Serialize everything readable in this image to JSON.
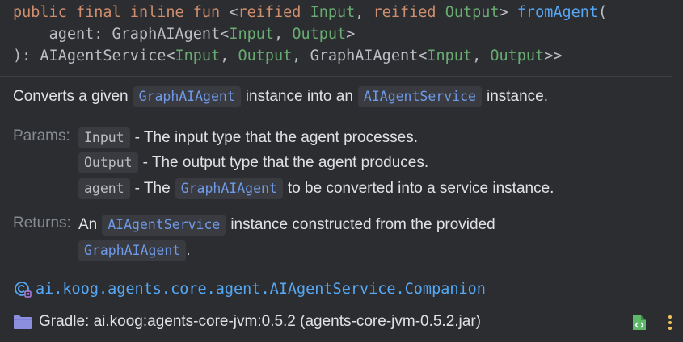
{
  "signature": {
    "line1": {
      "kw_public": "public",
      "kw_final": "final",
      "kw_inline": "inline",
      "kw_fun": "fun",
      "lt": "<",
      "kw_reified1": "reified",
      "type_input": "Input",
      "comma": ",",
      "kw_reified2": "reified",
      "type_output": "Output",
      "gt": ">",
      "fn_name": "fromAgent",
      "paren_open": "("
    },
    "line2": {
      "param": "agent: GraphAIAgent<",
      "type_input": "Input",
      "comma": ", ",
      "type_output": "Output",
      "close": ">"
    },
    "line3": {
      "start": "): AIAgentService<",
      "type_input1": "Input",
      "comma1": ", ",
      "type_output1": "Output",
      "mid": ", GraphAIAgent<",
      "type_input2": "Input",
      "comma2": ", ",
      "type_output2": "Output",
      "end": ">>"
    }
  },
  "description": {
    "part1": "Converts a given",
    "code1": "GraphAIAgent",
    "part2": "instance into an",
    "code2": "AIAgentService",
    "part3": "instance."
  },
  "params": {
    "label": "Params:",
    "items": [
      {
        "name": "Input",
        "text": "- The input type that the agent processes."
      },
      {
        "name": "Output",
        "text": "- The output type that the agent produces."
      },
      {
        "name": "agent",
        "text_before": "- The",
        "code": "GraphAIAgent",
        "text_after": "to be converted into a service instance."
      }
    ]
  },
  "returns": {
    "label": "Returns:",
    "part1": "An",
    "code1": "AIAgentService",
    "part2": "instance constructed from the provided",
    "code2": "GraphAIAgent",
    "part3": "."
  },
  "package_link": "ai.koog.agents.core.agent.AIAgentService.Companion",
  "footer": {
    "text": "Gradle: ai.koog:agents-core-jvm:0.5.2 (agents-core-jvm-0.5.2.jar)"
  },
  "colors": {
    "background": "#2b2d30",
    "keyword": "#cf8e6d",
    "type": "#6aab73",
    "function": "#56a8f5",
    "link": "#6f9ae8",
    "code_bg": "#393b40"
  }
}
